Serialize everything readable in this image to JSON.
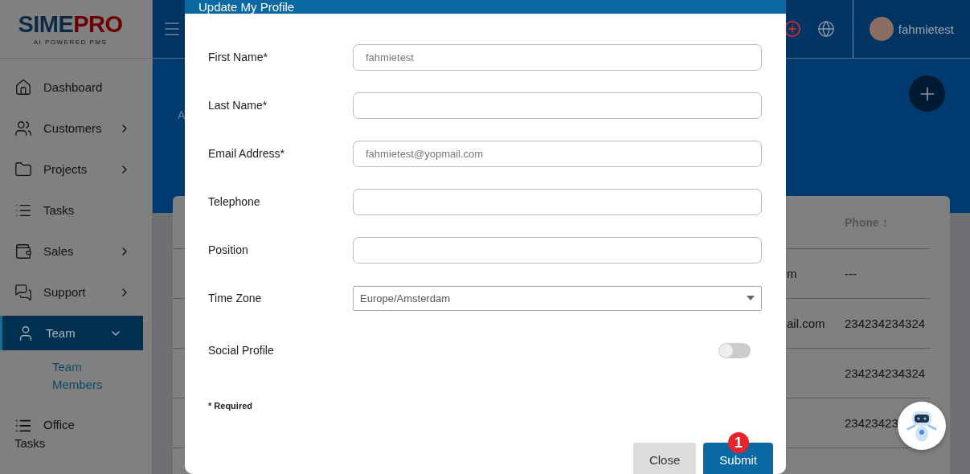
{
  "logo": {
    "primary": "SIME",
    "secondary": "PRO",
    "tagline": "AI POWERED PMS"
  },
  "sidebar": {
    "items": [
      {
        "label": "Dashboard",
        "expandable": false,
        "selected": false
      },
      {
        "label": "Customers",
        "expandable": true,
        "selected": false
      },
      {
        "label": "Projects",
        "expandable": true,
        "selected": false
      },
      {
        "label": "Tasks",
        "expandable": false,
        "selected": false
      },
      {
        "label": "Sales",
        "expandable": true,
        "selected": false
      },
      {
        "label": "Support",
        "expandable": true,
        "selected": false
      },
      {
        "label": "Team",
        "expandable": true,
        "expanded": true,
        "selected": true,
        "children": [
          {
            "label": "Team Members"
          }
        ]
      },
      {
        "label": "Office Tasks",
        "expandable": false,
        "selected": false
      }
    ]
  },
  "topbar": {
    "user": "fahmietest"
  },
  "breadcrumb": "A",
  "table": {
    "phone_header": "Phone ↕",
    "rows": [
      [
        "m",
        "---"
      ],
      [
        "ail.com",
        "234234234324"
      ],
      [
        "",
        "234234234324"
      ],
      [
        "",
        "23423423"
      ]
    ]
  },
  "modal": {
    "title": "Update My Profile",
    "fields": [
      {
        "kind": "text",
        "label": "First Name*",
        "value": "fahmietest"
      },
      {
        "kind": "text",
        "label": "Last Name*"
      },
      {
        "kind": "text",
        "label": "Email Address*",
        "value": "fahmietest@yopmail.com"
      },
      {
        "kind": "text",
        "label": "Telephone"
      },
      {
        "kind": "text",
        "label": "Position"
      },
      {
        "kind": "select",
        "label": "Time Zone",
        "value": "Europe/Amsterdam"
      },
      {
        "kind": "toggle",
        "label": "Social Profile",
        "on": false
      }
    ],
    "note": "* Required",
    "buttons": [
      {
        "label": "Close",
        "kind": "secondary"
      },
      {
        "label": "Submit",
        "kind": "primary",
        "badge": "1"
      }
    ]
  }
}
